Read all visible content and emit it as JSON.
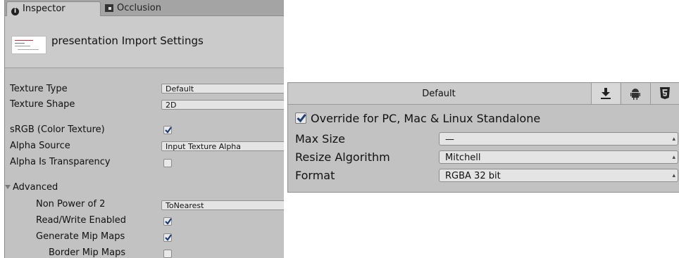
{
  "inspector": {
    "tabs": [
      {
        "label": "Inspector",
        "icon": "info-icon",
        "active": true
      },
      {
        "label": "Occlusion",
        "icon": "occlusion-icon",
        "active": false
      }
    ],
    "header_title": "presentation Import Settings",
    "properties": {
      "texture_type": {
        "label": "Texture Type",
        "value": "Default"
      },
      "texture_shape": {
        "label": "Texture Shape",
        "value": "2D"
      },
      "srgb": {
        "label": "sRGB (Color Texture)",
        "checked": true
      },
      "alpha_source": {
        "label": "Alpha Source",
        "value": "Input Texture Alpha"
      },
      "alpha_is_transparency": {
        "label": "Alpha Is Transparency",
        "checked": false
      },
      "advanced": {
        "label": "Advanced",
        "expanded": true
      },
      "non_power_of_2": {
        "label": "Non Power of 2",
        "value": "ToNearest"
      },
      "read_write": {
        "label": "Read/Write Enabled",
        "checked": true
      },
      "generate_mip": {
        "label": "Generate Mip Maps",
        "checked": true
      },
      "border_mip": {
        "label": "Border Mip Maps",
        "checked": false
      }
    }
  },
  "platform": {
    "title": "Default",
    "tabs": [
      {
        "icon": "download-icon",
        "selected": true
      },
      {
        "icon": "android-icon",
        "selected": false
      },
      {
        "icon": "html5-icon",
        "selected": false
      }
    ],
    "override_label": "Override for PC, Mac & Linux Standalone",
    "override_checked": true,
    "max_size": {
      "label": "Max Size",
      "value": "—"
    },
    "resize_algorithm": {
      "label": "Resize Algorithm",
      "value": "Mitchell"
    },
    "format": {
      "label": "Format",
      "value": "RGBA 32 bit"
    }
  }
}
